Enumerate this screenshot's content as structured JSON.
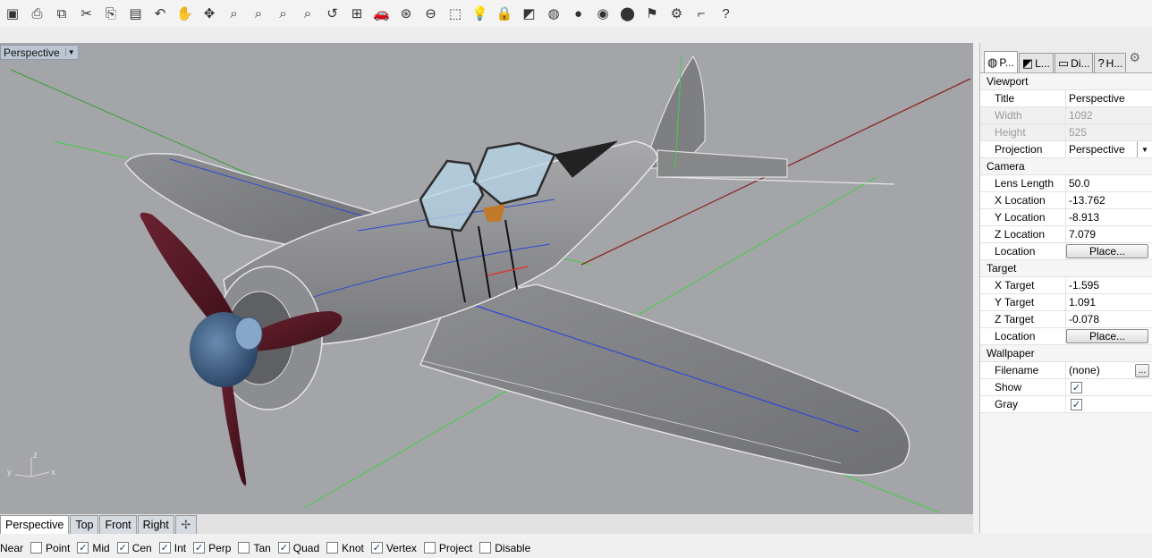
{
  "toolbar": {
    "buttons": [
      {
        "name": "save",
        "glyph": "▣"
      },
      {
        "name": "print",
        "glyph": "⎙"
      },
      {
        "name": "copy-to-layer",
        "glyph": "⧉"
      },
      {
        "name": "cut",
        "glyph": "✂"
      },
      {
        "name": "copy",
        "glyph": "⎘"
      },
      {
        "name": "paste",
        "glyph": "▤"
      },
      {
        "name": "undo",
        "glyph": "↶"
      },
      {
        "name": "pan",
        "glyph": "✋"
      },
      {
        "name": "rotate-view",
        "glyph": "✥"
      },
      {
        "name": "zoom",
        "glyph": "⌕"
      },
      {
        "name": "zoom-window",
        "glyph": "⌕"
      },
      {
        "name": "zoom-extents",
        "glyph": "⌕"
      },
      {
        "name": "zoom-selected",
        "glyph": "⌕"
      },
      {
        "name": "undo-view",
        "glyph": "↺"
      },
      {
        "name": "four-viewports",
        "glyph": "⊞"
      },
      {
        "name": "named-views",
        "glyph": "🚗"
      },
      {
        "name": "named-cplanes",
        "glyph": "⊛"
      },
      {
        "name": "cplane",
        "glyph": "⊖"
      },
      {
        "name": "select",
        "glyph": "⬚"
      },
      {
        "name": "lights",
        "glyph": "💡"
      },
      {
        "name": "lock",
        "glyph": "🔒"
      },
      {
        "name": "layers",
        "glyph": "◩"
      },
      {
        "name": "color-wheel",
        "glyph": "◍"
      },
      {
        "name": "shaded",
        "glyph": "●"
      },
      {
        "name": "rendered",
        "glyph": "◉"
      },
      {
        "name": "render",
        "glyph": "⬤"
      },
      {
        "name": "properties-flag",
        "glyph": "⚑"
      },
      {
        "name": "options",
        "glyph": "⚙"
      },
      {
        "name": "snap-toggle",
        "glyph": "⌐"
      },
      {
        "name": "help",
        "glyph": "?"
      }
    ]
  },
  "viewport": {
    "title": "Perspective",
    "axis": {
      "x": "x",
      "y": "y",
      "z": "z"
    }
  },
  "viewport_tabs": [
    {
      "label": "Perspective",
      "active": true
    },
    {
      "label": "Top",
      "active": false
    },
    {
      "label": "Front",
      "active": false
    },
    {
      "label": "Right",
      "active": false
    }
  ],
  "add_tab_glyph": "✢",
  "osnap": [
    {
      "label": "Near",
      "checked": null
    },
    {
      "label": "Point",
      "checked": false
    },
    {
      "label": "Mid",
      "checked": true
    },
    {
      "label": "Cen",
      "checked": true
    },
    {
      "label": "Int",
      "checked": true
    },
    {
      "label": "Perp",
      "checked": true
    },
    {
      "label": "Tan",
      "checked": false
    },
    {
      "label": "Quad",
      "checked": true
    },
    {
      "label": "Knot",
      "checked": false
    },
    {
      "label": "Vertex",
      "checked": true
    },
    {
      "label": "Project",
      "checked": false
    },
    {
      "label": "Disable",
      "checked": false
    }
  ],
  "panel": {
    "tabs": [
      {
        "label": "P...",
        "icon": "◍",
        "active": true
      },
      {
        "label": "L...",
        "icon": "◩",
        "active": false
      },
      {
        "label": "Di...",
        "icon": "▭",
        "active": false
      },
      {
        "label": "H...",
        "icon": "?",
        "active": false
      }
    ],
    "viewport_section": "Viewport",
    "title_label": "Title",
    "title_value": "Perspective",
    "width_label": "Width",
    "width_value": "1092",
    "height_label": "Height",
    "height_value": "525",
    "projection_label": "Projection",
    "projection_value": "Perspective",
    "camera_section": "Camera",
    "lens_label": "Lens Length",
    "lens_value": "50.0",
    "xloc_label": "X Location",
    "xloc_value": "-13.762",
    "yloc_label": "Y Location",
    "yloc_value": "-8.913",
    "zloc_label": "Z Location",
    "zloc_value": "7.079",
    "cam_location_label": "Location",
    "place_label": "Place...",
    "target_section": "Target",
    "xt_label": "X Target",
    "xt_value": "-1.595",
    "yt_label": "Y Target",
    "yt_value": "1.091",
    "zt_label": "Z Target",
    "zt_value": "-0.078",
    "tgt_location_label": "Location",
    "wallpaper_section": "Wallpaper",
    "filename_label": "Filename",
    "filename_value": "(none)",
    "browse_label": "...",
    "show_label": "Show",
    "show_checked": true,
    "gray_label": "Gray",
    "gray_checked": true
  }
}
